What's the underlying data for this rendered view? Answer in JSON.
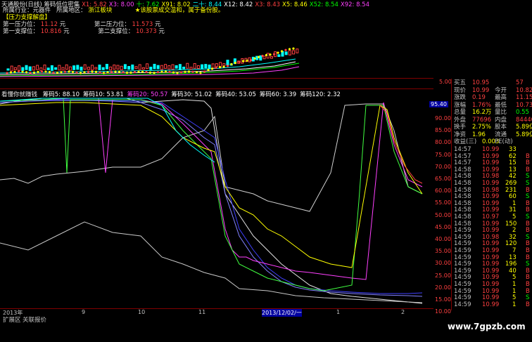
{
  "top": {
    "title": "天通股份(日线)",
    "indicator_name": "筹码低位密集",
    "indicators": [
      {
        "label": "X1: 5.82",
        "color": "#ff4040"
      },
      {
        "label": "X3: 8.00",
        "color": "#ff40ff"
      },
      {
        "label": "十: 7.62",
        "color": "#00ff00"
      },
      {
        "label": "X91: 8.02",
        "color": "#ffff00"
      },
      {
        "label": "二十: 8.44",
        "color": "#00ffff"
      },
      {
        "label": "X12: 8.42",
        "color": "#ffffff"
      },
      {
        "label": "X3: 8.43",
        "color": "#ff4040"
      },
      {
        "label": "X5: 8.46",
        "color": "#ffff00"
      },
      {
        "label": "X52: 8.54",
        "color": "#00ff00"
      },
      {
        "label": "X92: 8.54",
        "color": "#ff40ff"
      }
    ],
    "line1_a": "所属地区：",
    "line1_b": "浙江板块",
    "line1_c": "★该股票成交温和，属于备份股。",
    "line1_left": "所属行业：元器件",
    "line2_left": "【压力支撑解盘】",
    "line3_a": "第一压力位：",
    "line3_b": "11.12",
    "line3_c": "元",
    "line3_d": "第二压力位：",
    "line3_e": "11.573",
    "line3_f": "元",
    "line4_a": "第一支撑位：",
    "line4_b": "10.816",
    "line4_c": "元",
    "line4_d": "第二支撑位：",
    "line4_e": "10.373",
    "line4_f": "元"
  },
  "indicator_pane": {
    "title": "看懂你就赚钱",
    "items": [
      {
        "label": "筹码5: 88.10",
        "color": "#ffffff"
      },
      {
        "label": "筹码10: 53.81",
        "color": "#ffffff"
      },
      {
        "label": "筹码20: 50.57",
        "color": "#ff40ff"
      },
      {
        "label": "筹码30: 51.02",
        "color": "#ffffff"
      },
      {
        "label": "筹码40: 53.05",
        "color": "#ffffff"
      },
      {
        "label": "筹码60: 3.39",
        "color": "#ffffff"
      },
      {
        "label": "筹码120: 2.32",
        "color": "#ffffff"
      }
    ]
  },
  "axis": {
    "top_label": "5.00",
    "current": "95.40",
    "ticks": [
      "90.00",
      "85.00",
      "80.00",
      "75.00",
      "70.00",
      "65.00",
      "60.00",
      "55.00",
      "50.00",
      "45.00",
      "40.00",
      "35.00",
      "30.00",
      "25.00",
      "20.00",
      "15.00",
      "10.00"
    ]
  },
  "quote": {
    "rows": [
      {
        "l1": "买五",
        "v1": "10.95",
        "l2": "",
        "v2": "57",
        "c1": "#ff4040"
      },
      {
        "l1": "现价",
        "v1": "10.99",
        "l2": "今开",
        "v2": "10.82",
        "c1": "#ff4040"
      },
      {
        "l1": "涨跌",
        "v1": "0.19",
        "l2": "最高",
        "v2": "11.15",
        "c1": "#ff4040"
      },
      {
        "l1": "涨幅",
        "v1": "1.76%",
        "l2": "最低",
        "v2": "10.73",
        "c1": "#ff4040"
      },
      {
        "l1": "总量",
        "v1": "16.2万",
        "l2": "量比",
        "v2": "0.55",
        "c1": "#ffff00"
      },
      {
        "l1": "外盘",
        "v1": "77696",
        "l2": "内盘",
        "v2": "84440",
        "c1": "#ff4040"
      },
      {
        "l1": "换手",
        "v1": "2.75%",
        "l2": "股本",
        "v2": "5.89亿",
        "c1": "#ffff00"
      },
      {
        "l1": "净资",
        "v1": "1.96",
        "l2": "流通",
        "v2": "5.89亿",
        "c1": "#ffff00"
      },
      {
        "l1": "收益(三)",
        "v1": "0.003",
        "l2": "PE(动)",
        "v2": "",
        "c1": "#ffff00"
      }
    ]
  },
  "ticks": [
    {
      "t": "14:57",
      "p": "10.99",
      "v": "33",
      "s": ""
    },
    {
      "t": "14:57",
      "p": "10.99",
      "v": "62",
      "s": "B"
    },
    {
      "t": "14:57",
      "p": "10.99",
      "v": "15",
      "s": "B"
    },
    {
      "t": "14:58",
      "p": "10.99",
      "v": "13",
      "s": "B"
    },
    {
      "t": "14:58",
      "p": "10.98",
      "v": "42",
      "s": "S"
    },
    {
      "t": "14:58",
      "p": "10.99",
      "v": "269",
      "s": "S"
    },
    {
      "t": "14:58",
      "p": "10.98",
      "v": "231",
      "s": "B"
    },
    {
      "t": "14:58",
      "p": "10.99",
      "v": "60",
      "s": "S"
    },
    {
      "t": "14:58",
      "p": "10.99",
      "v": "1",
      "s": "B"
    },
    {
      "t": "14:58",
      "p": "10.99",
      "v": "31",
      "s": "B"
    },
    {
      "t": "14:58",
      "p": "10.97",
      "v": "5",
      "s": "S"
    },
    {
      "t": "14:58",
      "p": "10.99",
      "v": "150",
      "s": "B"
    },
    {
      "t": "14:59",
      "p": "10.99",
      "v": "2",
      "s": "B"
    },
    {
      "t": "14:59",
      "p": "10.98",
      "v": "32",
      "s": "S"
    },
    {
      "t": "14:59",
      "p": "10.99",
      "v": "120",
      "s": "B"
    },
    {
      "t": "14:59",
      "p": "10.99",
      "v": "7",
      "s": "B"
    },
    {
      "t": "14:59",
      "p": "10.99",
      "v": "13",
      "s": "B"
    },
    {
      "t": "14:59",
      "p": "10.99",
      "v": "196",
      "s": "S"
    },
    {
      "t": "14:59",
      "p": "10.99",
      "v": "40",
      "s": "B"
    },
    {
      "t": "14:59",
      "p": "10.99",
      "v": "5",
      "s": "B"
    },
    {
      "t": "14:59",
      "p": "10.99",
      "v": "1",
      "s": "B"
    },
    {
      "t": "14:59",
      "p": "10.99",
      "v": "1",
      "s": "B"
    },
    {
      "t": "14:59",
      "p": "10.99",
      "v": "5",
      "s": "S"
    },
    {
      "t": "14:59",
      "p": "10.99",
      "v": "1",
      "s": "B"
    }
  ],
  "date_axis": {
    "labels": [
      "2013年",
      "9",
      "10",
      "11",
      "2013/12/02/一",
      "1",
      "2"
    ]
  },
  "status": {
    "tab_label": "扩展区",
    "tab2_label": "关联报价"
  },
  "watermark": "www.7gpzb.com",
  "colors": {
    "frame": "#800000",
    "up": "#ff4040",
    "down": "#00ff00",
    "label": "#ffff00"
  }
}
